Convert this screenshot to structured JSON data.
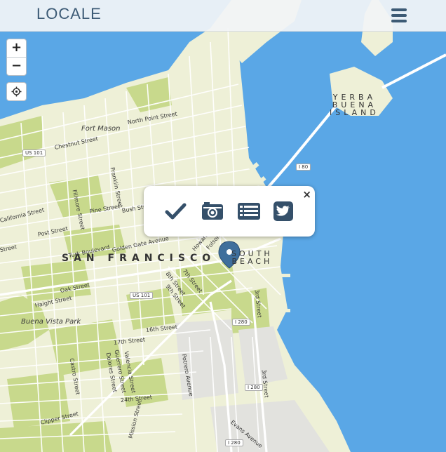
{
  "header": {
    "brand": "LOCALE"
  },
  "map_controls": {
    "zoom_in": "+",
    "zoom_out": "−"
  },
  "popup": {
    "close": "×",
    "actions": [
      "check-icon",
      "camera-icon",
      "list-icon",
      "twitter-icon"
    ]
  },
  "labels": {
    "city": "SAN FRANCISCO",
    "yerba_buena": "YERBA\nBUENA\nISLAND",
    "south_beach": "SOUTH\nBEACH",
    "neighborhoods": {
      "fort_mason": "Fort Mason",
      "buena_vista": "Buena Vista Park"
    },
    "streets": {
      "north_point": "North Point Street",
      "chestnut": "Chestnut Street",
      "california": "California Street",
      "post": "Post Street",
      "pine": "Pine Street",
      "bush": "Bush Street",
      "franklin": "Franklin Street",
      "fillmore": "Fillmore Street",
      "turk": "Turk Boulevard",
      "golden_gate": "Golden Gate Avenue",
      "oak": "Oak Street",
      "haight": "Haight Street",
      "16th": "16th Street",
      "17th": "17th Street",
      "7th": "7th Street",
      "8th": "8th Street",
      "9th": "9th Street",
      "castro": "Castro Street",
      "valencia": "Valencia Street",
      "guerrero": "Guerrero Street",
      "dolores": "Dolores Street",
      "24th": "24th Street",
      "clipper": "Clipper Street",
      "mission": "Mission Street",
      "potrero": "Potrero Avenue",
      "3rd": "3rd Street",
      "evans": "Evans Avenue",
      "howard": "Howard",
      "folsom": "Folsom",
      "street_left": "Street"
    },
    "shields": {
      "us101_a": "US 101",
      "us101_b": "US 101",
      "i80": "I 80",
      "i280_a": "I 280",
      "i280_b": "I 280",
      "i280_c": "I 280"
    }
  },
  "colors": {
    "water": "#5aa7e6",
    "land": "#eef0d7",
    "park": "#c8d98c",
    "road": "#ffffff",
    "marker": "#3f6f9c",
    "brand": "#3c5a75"
  }
}
